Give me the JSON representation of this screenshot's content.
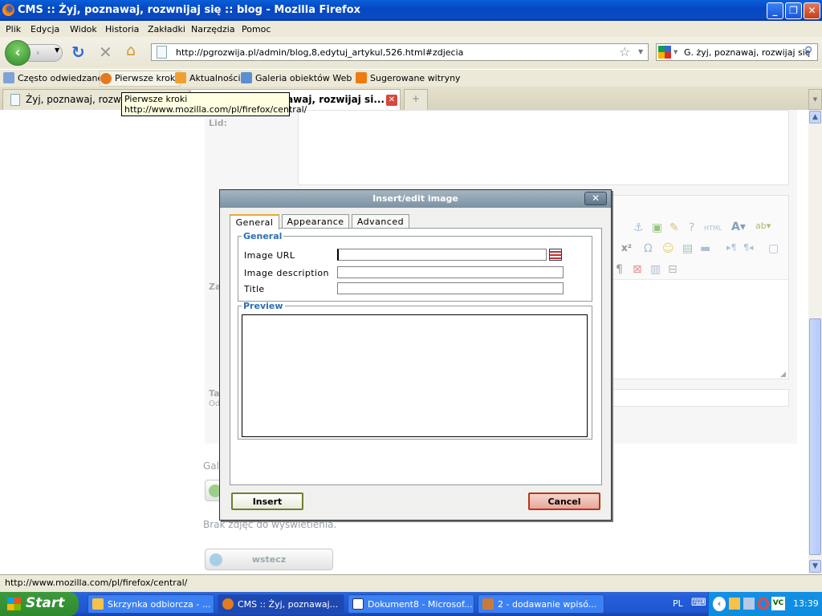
{
  "window": {
    "title": "CMS :: Żyj, poznawaj, rozwnijaj się :: blog - Mozilla Firefox",
    "min": "_",
    "max": "❐",
    "close": "✕"
  },
  "menu": [
    "Plik",
    "Edycja",
    "Widok",
    "Historia",
    "Zakładki",
    "Narzędzia",
    "Pomoc"
  ],
  "nav": {
    "url": "http://pgrozwija.pl/admin/blog,8,edytuj_artykul,526.html#zdjecia",
    "search_value": "G. żyj, poznawaj, rozwijaj się"
  },
  "bookmarks": [
    "Często odwiedzane",
    "Pierwsze kroki",
    "Aktualności",
    "Galeria obiektów Web ...",
    "Sugerowane witryny"
  ],
  "tabs": [
    {
      "label": "Żyj, poznawaj, rozwijaj się",
      "active": false
    },
    {
      "label": "CMS :: Żyj, poznawaj, rozwijaj si...",
      "active": true
    }
  ],
  "tooltip": {
    "title": "Pierwsze kroki",
    "url": "http://www.mozilla.com/pl/firefox/central/"
  },
  "page": {
    "lid_label": "Lid:",
    "content_label": "Za",
    "tags_label": "Ta",
    "tags_hint": "Od",
    "gallery_label": "Gal",
    "no_photos": "Brak zdjęć do wyświetlenia.",
    "back_button": "wstecz",
    "editor_html": "HTML"
  },
  "dialog": {
    "title": "Insert/edit image",
    "tabs": [
      "General",
      "Appearance",
      "Advanced"
    ],
    "active_tab": "General",
    "general_legend": "General",
    "image_url_label": "Image URL",
    "image_url": "",
    "image_description_label": "Image description",
    "image_description": "",
    "title_label": "Title",
    "title_value": "",
    "preview_legend": "Preview",
    "insert": "Insert",
    "cancel": "Cancel"
  },
  "status": "http://www.mozilla.com/pl/firefox/central/",
  "taskbar": {
    "start": "Start",
    "tasks": [
      {
        "label": "Skrzynka odbiorcza - ...",
        "active": false
      },
      {
        "label": "CMS :: Żyj, poznawaj...",
        "active": true
      },
      {
        "label": "Dokument8 - Microsof...",
        "active": false
      },
      {
        "label": "2 - dodawanie wpisó...",
        "active": false
      }
    ],
    "lang": "PL",
    "clock": "13:39"
  }
}
